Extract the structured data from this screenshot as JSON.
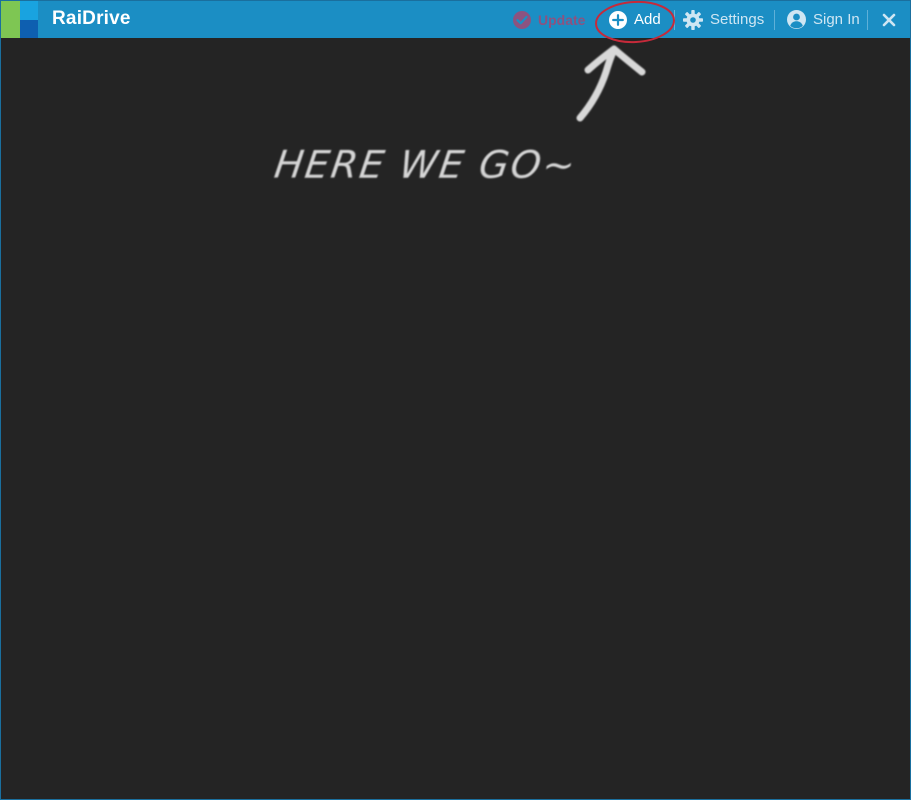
{
  "app": {
    "title": "RaiDrive",
    "accent_color": "#1b8ec4"
  },
  "toolbar": {
    "update_label": "Update",
    "update_icon": "check-circle-icon",
    "add_label": "Add",
    "add_icon": "plus-circle-icon",
    "settings_label": "Settings",
    "settings_icon": "gear-icon",
    "signin_label": "Sign In",
    "signin_icon": "user-circle-icon",
    "close_icon": "close-icon"
  },
  "annotation": {
    "text": "HERE WE GO~",
    "highlight_color": "#c62a3a",
    "arrow_icon": "hand-drawn-arrow-up-icon"
  }
}
